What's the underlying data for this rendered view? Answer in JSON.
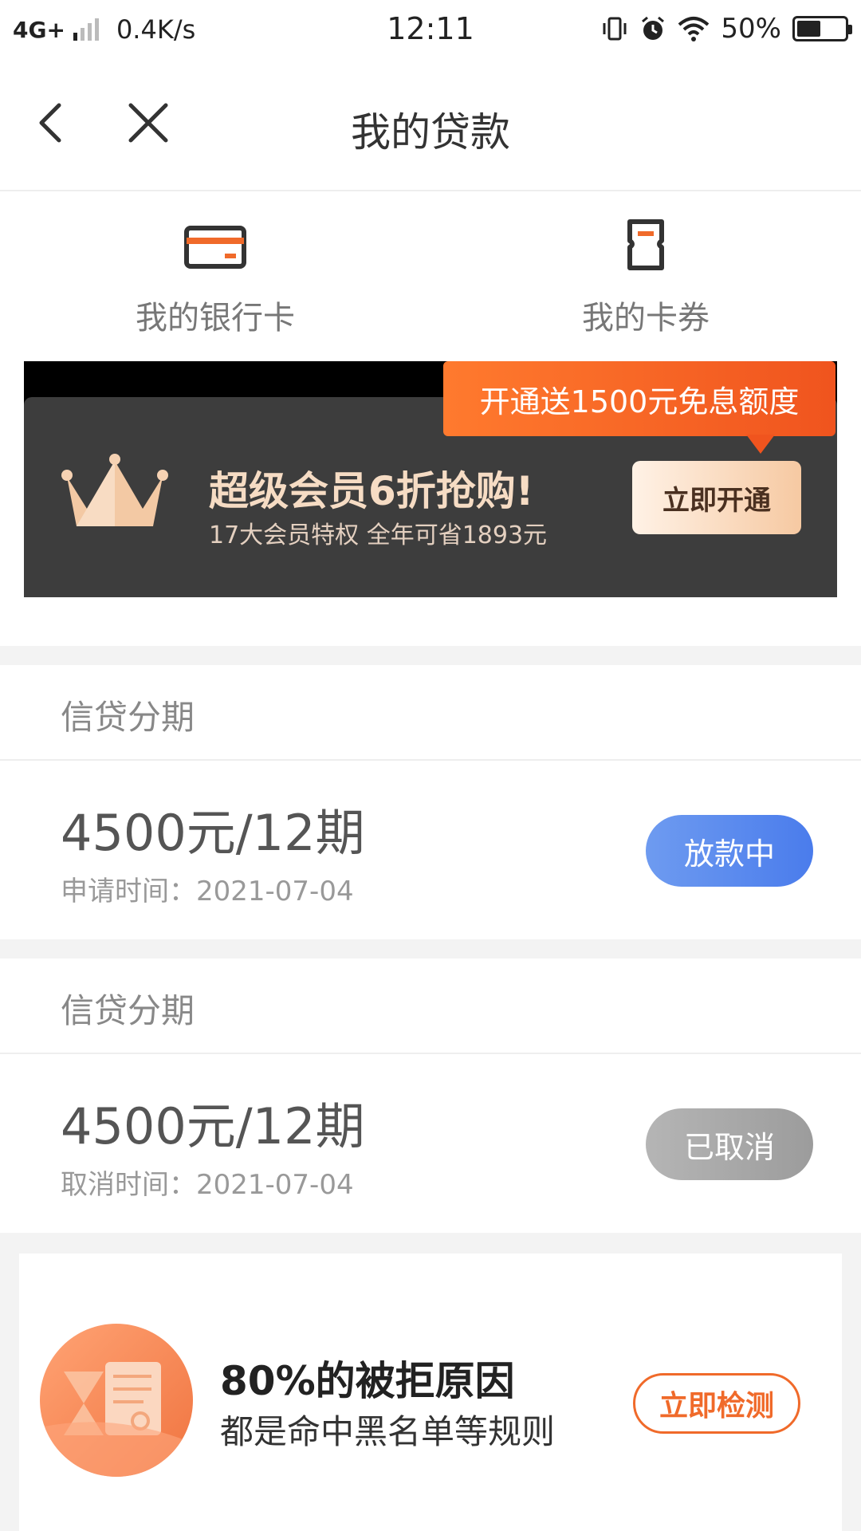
{
  "status_bar": {
    "network": "4G+",
    "speed": "0.4K/s",
    "time": "12:11",
    "battery": "50%",
    "battery_level": 0.5
  },
  "nav": {
    "title": "我的贷款"
  },
  "shortcuts": [
    {
      "label": "我的银行卡",
      "icon": "bank-card-icon"
    },
    {
      "label": "我的卡券",
      "icon": "coupon-icon"
    }
  ],
  "vip_banner": {
    "tag": "开通送1500元免息额度",
    "title": "超级会员6折抢购!",
    "subtitle": "17大会员特权  全年可省1893元",
    "button": "立即开通",
    "icon": "crown-icon"
  },
  "loans": [
    {
      "category": "信贷分期",
      "amount": "4500元/12期",
      "date": "申请时间：2021-07-04",
      "status": "放款中"
    },
    {
      "category": "信贷分期",
      "amount": "4500元/12期",
      "date": "取消时间：2021-07-04",
      "status": "已取消"
    }
  ],
  "promo": {
    "line1": "80%的被拒原因",
    "line2": "都是命中黑名单等规则",
    "button": "立即检测",
    "icon": "report-hourglass-icon"
  },
  "colors": {
    "accent_orange": "#f06a2a",
    "processing_blue": "#4a7cec",
    "cancelled_gray": "#a8a8a8",
    "banner_dark": "#3d3d3d"
  }
}
